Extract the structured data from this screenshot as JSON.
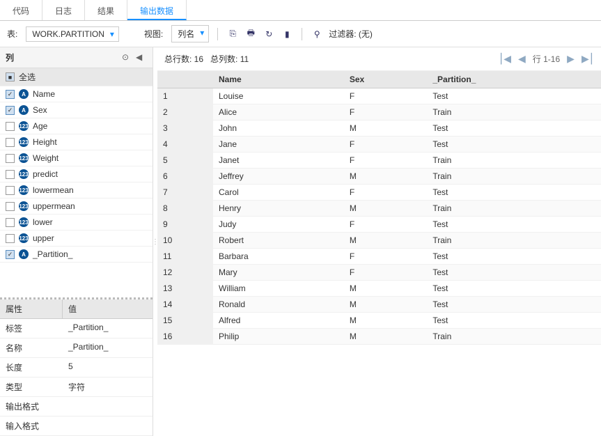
{
  "tabs": {
    "code": "代码",
    "log": "日志",
    "results": "结果",
    "output": "输出数据"
  },
  "toolbar": {
    "table_label": "表:",
    "table_value": "WORK.PARTITION",
    "view_label": "视图:",
    "view_value": "列名",
    "filter_label": "过滤器: (无)"
  },
  "sidebar": {
    "title": "列",
    "select_all": "全选",
    "columns": [
      {
        "name": "Name",
        "type": "A",
        "checked": true
      },
      {
        "name": "Sex",
        "type": "A",
        "checked": true
      },
      {
        "name": "Age",
        "type": "123",
        "checked": false
      },
      {
        "name": "Height",
        "type": "123",
        "checked": false
      },
      {
        "name": "Weight",
        "type": "123",
        "checked": false
      },
      {
        "name": "predict",
        "type": "123",
        "checked": false
      },
      {
        "name": "lowermean",
        "type": "123",
        "checked": false
      },
      {
        "name": "uppermean",
        "type": "123",
        "checked": false
      },
      {
        "name": "lower",
        "type": "123",
        "checked": false
      },
      {
        "name": "upper",
        "type": "123",
        "checked": false
      },
      {
        "name": "_Partition_",
        "type": "A",
        "checked": true
      }
    ],
    "props_header": {
      "attr": "属性",
      "val": "值"
    },
    "props": [
      {
        "k": "标签",
        "v": "_Partition_"
      },
      {
        "k": "名称",
        "v": "_Partition_"
      },
      {
        "k": "长度",
        "v": "5"
      },
      {
        "k": "类型",
        "v": "字符"
      },
      {
        "k": "输出格式",
        "v": ""
      },
      {
        "k": "输入格式",
        "v": ""
      }
    ]
  },
  "stats": {
    "rows": "总行数: 16",
    "cols": "总列数: 11",
    "range": "行 1-16"
  },
  "table": {
    "headers": [
      "",
      "Name",
      "Sex",
      "_Partition_"
    ],
    "rows": [
      [
        "1",
        "Louise",
        "F",
        "Test"
      ],
      [
        "2",
        "Alice",
        "F",
        "Train"
      ],
      [
        "3",
        "John",
        "M",
        "Test"
      ],
      [
        "4",
        "Jane",
        "F",
        "Test"
      ],
      [
        "5",
        "Janet",
        "F",
        "Train"
      ],
      [
        "6",
        "Jeffrey",
        "M",
        "Train"
      ],
      [
        "7",
        "Carol",
        "F",
        "Test"
      ],
      [
        "8",
        "Henry",
        "M",
        "Train"
      ],
      [
        "9",
        "Judy",
        "F",
        "Test"
      ],
      [
        "10",
        "Robert",
        "M",
        "Train"
      ],
      [
        "11",
        "Barbara",
        "F",
        "Test"
      ],
      [
        "12",
        "Mary",
        "F",
        "Test"
      ],
      [
        "13",
        "William",
        "M",
        "Test"
      ],
      [
        "14",
        "Ronald",
        "M",
        "Test"
      ],
      [
        "15",
        "Alfred",
        "M",
        "Test"
      ],
      [
        "16",
        "Philip",
        "M",
        "Train"
      ]
    ]
  }
}
